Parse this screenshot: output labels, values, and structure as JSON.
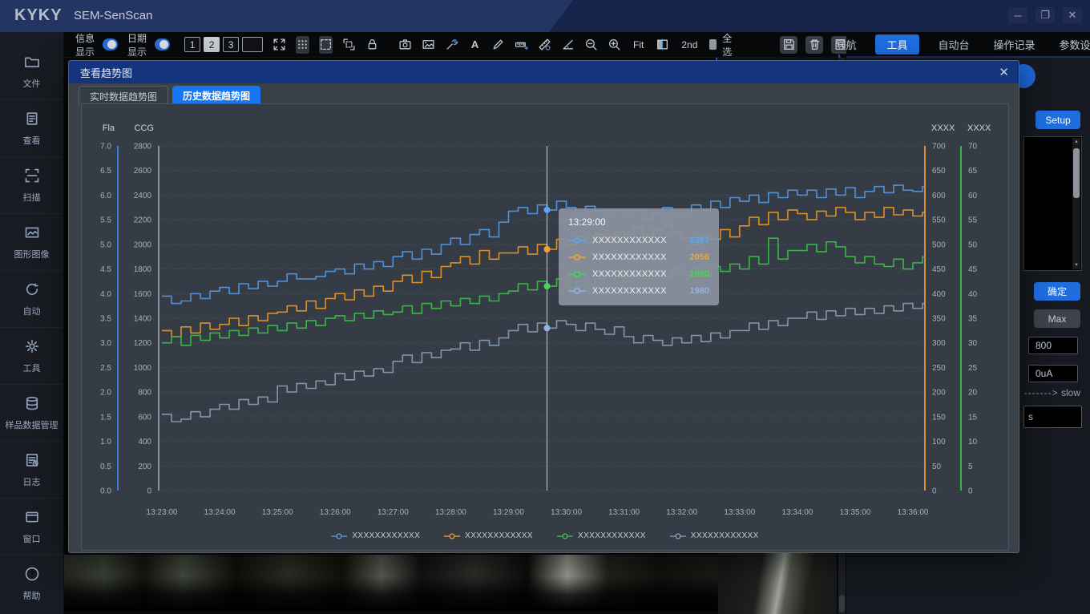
{
  "window": {
    "brand": "KYKY",
    "title": "SEM-SenScan",
    "controls": {
      "minimize": "─",
      "maximize": "❐",
      "close": "✕"
    }
  },
  "sidebar": {
    "items": [
      {
        "icon": "folder-icon",
        "label": "文件"
      },
      {
        "icon": "view-icon",
        "label": "查看"
      },
      {
        "icon": "scan-icon",
        "label": "扫描"
      },
      {
        "icon": "image-icon",
        "label": "图形图像"
      },
      {
        "icon": "auto-icon",
        "label": "自动"
      },
      {
        "icon": "gear-icon",
        "label": "工具"
      },
      {
        "icon": "database-icon",
        "label": "样品数据管理"
      },
      {
        "icon": "log-icon",
        "label": "日志"
      },
      {
        "icon": "window-icon",
        "label": "窗口"
      },
      {
        "icon": "help-icon",
        "label": "帮助"
      }
    ]
  },
  "toolbar": {
    "toggles": [
      {
        "label": "信息显示",
        "on": true
      },
      {
        "label": "日期显示",
        "on": true
      }
    ],
    "number_buttons": [
      "1",
      "2",
      "3",
      ""
    ],
    "fit_label": "Fit",
    "second_label": "2nd",
    "select_all_label": "全选"
  },
  "top_menu": {
    "items": [
      {
        "label": "导航",
        "active": false
      },
      {
        "label": "工具",
        "active": true
      },
      {
        "label": "自动台",
        "active": false
      },
      {
        "label": "操作记录",
        "active": false
      },
      {
        "label": "参数设置",
        "active": false
      }
    ]
  },
  "right_panel": {
    "setup_label": "Setup",
    "confirm_label": "确定",
    "max_label": "Max",
    "input1": "800",
    "input2": "0uA",
    "slow_arrow": "-------&gt;",
    "slow_dashes": "------->",
    "slow_label": "slow",
    "bottom_input": "s"
  },
  "modal": {
    "title": "查看趋势图",
    "close_icon": "✕",
    "tabs": [
      {
        "label": "实时数据趋势图",
        "active": false
      },
      {
        "label": "历史数据趋势图",
        "active": true
      }
    ]
  },
  "chart_data": {
    "type": "line",
    "step": true,
    "grid": true,
    "x_start": "13:23:00",
    "x_interval_seconds": 10,
    "x_tick_labels": [
      "13:23:00",
      "13:24:00",
      "13:25:00",
      "13:26:00",
      "13:27:00",
      "13:28:00",
      "13:29:00",
      "13:30:00",
      "13:31:00",
      "13:32:00",
      "13:33:00",
      "13:34:00",
      "13:35:00",
      "13:36:00"
    ],
    "axes": [
      {
        "name": "Fla",
        "side": "left",
        "color": "#3f7fd6",
        "range": [
          0,
          7
        ],
        "ticks": [
          "7.0",
          "6.5",
          "6.0",
          "5.5",
          "5.0",
          "4.5",
          "4.0",
          "3.5",
          "3.0",
          "2.5",
          "2.0",
          "1.5",
          "1.0",
          "0.5",
          "0.0"
        ]
      },
      {
        "name": "CCG",
        "side": "left",
        "color": "#8a93a0",
        "range": [
          0,
          2800
        ],
        "ticks": [
          "2800",
          "2600",
          "2400",
          "2200",
          "2000",
          "1800",
          "1600",
          "1400",
          "1200",
          "1000",
          "800",
          "600",
          "400",
          "200",
          "0"
        ]
      },
      {
        "name": "XXXX",
        "side": "right",
        "color": "#d9912f",
        "range": [
          0,
          700
        ],
        "ticks": [
          "700",
          "650",
          "600",
          "550",
          "500",
          "450",
          "400",
          "350",
          "300",
          "250",
          "200",
          "150",
          "100",
          "50",
          "0"
        ]
      },
      {
        "name": "XXXX",
        "side": "right",
        "color": "#3db34a",
        "range": [
          0,
          70
        ],
        "ticks": [
          "70",
          "65",
          "60",
          "55",
          "50",
          "45",
          "40",
          "35",
          "30",
          "25",
          "20",
          "15",
          "10",
          "5",
          "0"
        ]
      }
    ],
    "series": [
      {
        "name": "XXXXXXXXXXXX",
        "color": "#5490d2",
        "values": [
          1580,
          1520,
          1540,
          1600,
          1560,
          1620,
          1650,
          1600,
          1680,
          1640,
          1700,
          1660,
          1700,
          1760,
          1720,
          1720,
          1740,
          1780,
          1800,
          1760,
          1840,
          1800,
          1860,
          1820,
          1900,
          1940,
          1880,
          1960,
          1920,
          2000,
          2050,
          2000,
          2080,
          2120,
          2060,
          2180,
          2270,
          2300,
          2250,
          2320,
          2280,
          2350,
          2300,
          2250,
          2310,
          2270,
          2230,
          2280,
          2230,
          2280,
          2200,
          2260,
          2300,
          2250,
          2250,
          2320,
          2280,
          2350,
          2300,
          2380,
          2350,
          2400,
          2340,
          2420,
          2380,
          2440,
          2400,
          2440,
          2380,
          2450,
          2400,
          2460,
          2380,
          2430,
          2470,
          2420,
          2480,
          2440,
          2430,
          2470
        ]
      },
      {
        "name": "XXXXXXXXXXXX",
        "color": "#d9912f",
        "values": [
          1300,
          1250,
          1330,
          1280,
          1360,
          1310,
          1350,
          1400,
          1340,
          1420,
          1380,
          1440,
          1450,
          1500,
          1460,
          1540,
          1480,
          1560,
          1600,
          1550,
          1630,
          1580,
          1660,
          1620,
          1700,
          1750,
          1690,
          1780,
          1730,
          1820,
          1850,
          1900,
          1840,
          1950,
          1880,
          1930,
          1930,
          1980,
          1920,
          2000,
          1960,
          2040,
          2000,
          2060,
          2010,
          2080,
          2040,
          2100,
          2080,
          2140,
          2060,
          2120,
          2160,
          2100,
          2050,
          2000,
          2080,
          2040,
          2120,
          2060,
          2150,
          2220,
          2160,
          2260,
          2200,
          2280,
          2250,
          2200,
          2270,
          2230,
          2300,
          2260,
          2200,
          2260,
          2220,
          2300,
          2240,
          2280,
          2230,
          2260
        ]
      },
      {
        "name": "XXXXXXXXXXXX",
        "color": "#3db34a",
        "values": [
          1200,
          1250,
          1180,
          1260,
          1220,
          1280,
          1240,
          1300,
          1260,
          1320,
          1280,
          1340,
          1300,
          1360,
          1320,
          1380,
          1340,
          1400,
          1420,
          1380,
          1440,
          1400,
          1460,
          1430,
          1450,
          1500,
          1440,
          1520,
          1480,
          1540,
          1500,
          1560,
          1520,
          1580,
          1540,
          1600,
          1620,
          1680,
          1630,
          1700,
          1660,
          1720,
          1650,
          1700,
          1640,
          1720,
          1680,
          1740,
          1700,
          1760,
          1720,
          1780,
          1740,
          1800,
          1750,
          1800,
          1740,
          1820,
          1780,
          1840,
          1800,
          1900,
          1840,
          2050,
          1880,
          1950,
          1950,
          2000,
          1940,
          2020,
          1980,
          1900,
          1850,
          1900,
          1840,
          1820,
          1880,
          1800,
          1850,
          1900
        ]
      },
      {
        "name": "XXXXXXXXXXXX",
        "color": "#8295ac",
        "values": [
          620,
          560,
          580,
          640,
          600,
          660,
          700,
          660,
          740,
          700,
          760,
          720,
          850,
          800,
          870,
          830,
          890,
          860,
          950,
          900,
          970,
          930,
          990,
          960,
          1050,
          1100,
          1040,
          1120,
          1080,
          1140,
          1150,
          1200,
          1140,
          1220,
          1180,
          1240,
          1300,
          1350,
          1290,
          1360,
          1320,
          1380,
          1350,
          1300,
          1360,
          1310,
          1270,
          1330,
          1250,
          1200,
          1260,
          1220,
          1180,
          1240,
          1200,
          1260,
          1210,
          1280,
          1240,
          1300,
          1300,
          1360,
          1310,
          1380,
          1340,
          1400,
          1400,
          1450,
          1390,
          1460,
          1420,
          1480,
          1430,
          1480,
          1440,
          1500,
          1460,
          1520,
          1480,
          1520
        ]
      }
    ],
    "crosshair": {
      "x_index": 40,
      "time": "13:29:00"
    },
    "tooltip": {
      "time": "13:29:00",
      "rows": [
        {
          "label": "XXXXXXXXXXXX",
          "value": "2367",
          "color": "#57a8ff"
        },
        {
          "label": "XXXXXXXXXXXX",
          "value": "2056",
          "color": "#f2a233"
        },
        {
          "label": "XXXXXXXXXXXX",
          "value": "1980",
          "color": "#45d653"
        },
        {
          "label": "XXXXXXXXXXXX",
          "value": "1980",
          "color": "#8fb4e3"
        }
      ]
    },
    "legend_position": "bottom"
  }
}
